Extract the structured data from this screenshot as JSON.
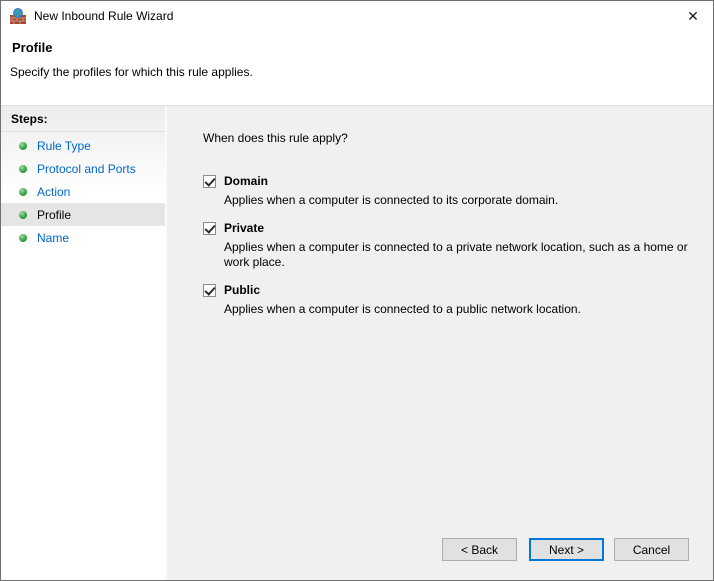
{
  "window": {
    "title": "New Inbound Rule Wizard",
    "close_glyph": "✕"
  },
  "header": {
    "title": "Profile",
    "subtitle": "Specify the profiles for which this rule applies."
  },
  "sidebar": {
    "heading": "Steps:",
    "items": [
      {
        "label": "Rule Type",
        "current": false
      },
      {
        "label": "Protocol and Ports",
        "current": false
      },
      {
        "label": "Action",
        "current": false
      },
      {
        "label": "Profile",
        "current": true
      },
      {
        "label": "Name",
        "current": false
      }
    ]
  },
  "main": {
    "question": "When does this rule apply?",
    "profiles": [
      {
        "label": "Domain",
        "checked": true,
        "description": "Applies when a computer is connected to its corporate domain."
      },
      {
        "label": "Private",
        "checked": true,
        "description": "Applies when a computer is connected to a private network location, such as a home or work place."
      },
      {
        "label": "Public",
        "checked": true,
        "description": "Applies when a computer is connected to a public network location."
      }
    ]
  },
  "buttons": {
    "back": "< Back",
    "next": "Next >",
    "cancel": "Cancel"
  },
  "colors": {
    "link_blue": "#0066cc",
    "step_bullet_green": "#3aa344",
    "focus_blue": "#0078d7",
    "main_background": "#f0f0f0",
    "current_step_highlight": "#e5e5e5"
  }
}
